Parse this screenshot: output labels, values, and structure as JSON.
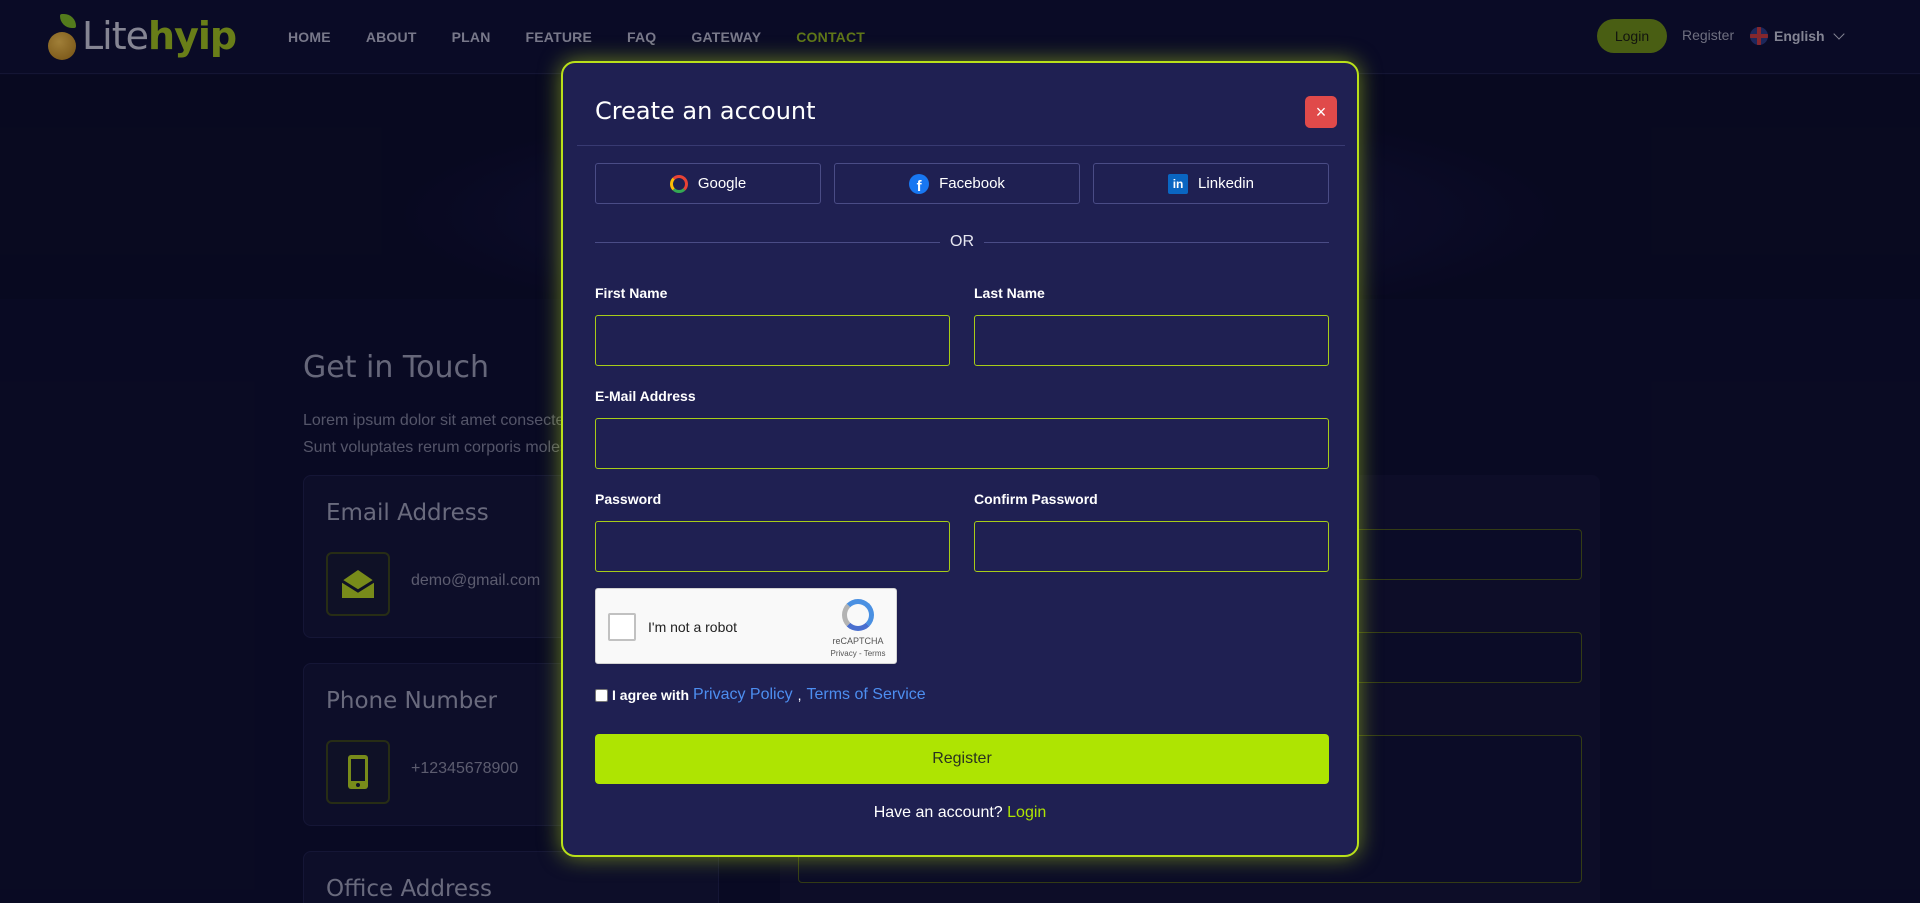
{
  "brand": {
    "lite": "Lite",
    "hyip": "hyip"
  },
  "nav": {
    "items": [
      {
        "label": "HOME"
      },
      {
        "label": "ABOUT"
      },
      {
        "label": "PLAN"
      },
      {
        "label": "FEATURE"
      },
      {
        "label": "FAQ"
      },
      {
        "label": "GATEWAY"
      },
      {
        "label": "CONTACT",
        "active": true
      }
    ],
    "login_label": "Login",
    "register_label": "Register",
    "language": "English"
  },
  "page": {
    "title": "Get in Touch",
    "intro_line1": "Lorem ipsum dolor sit amet consectetur",
    "intro_line2": "Sunt voluptates rerum corporis molestias",
    "cards": [
      {
        "title": "Email Address",
        "value": "demo@gmail.com",
        "icon": "envelope-icon"
      },
      {
        "title": "Phone Number",
        "value": "+12345678900",
        "icon": "phone-icon"
      },
      {
        "title": "Office Address",
        "value": "",
        "icon": "location-icon"
      }
    ]
  },
  "modal": {
    "title": "Create an account",
    "close_icon": "×",
    "social": [
      {
        "label": "Google",
        "icon": "google-icon"
      },
      {
        "label": "Facebook",
        "icon": "facebook-icon"
      },
      {
        "label": "Linkedin",
        "icon": "linkedin-icon"
      }
    ],
    "or_text": "OR",
    "fields": {
      "first_name": {
        "label": "First Name",
        "value": ""
      },
      "last_name": {
        "label": "Last Name",
        "value": ""
      },
      "email": {
        "label": "E-Mail Address",
        "value": ""
      },
      "password": {
        "label": "Password",
        "value": ""
      },
      "confirm_password": {
        "label": "Confirm Password",
        "value": ""
      }
    },
    "captcha": {
      "label": "I'm not a robot",
      "brand": "reCAPTCHA",
      "terms": "Privacy - Terms"
    },
    "agree": {
      "text": "I agree with",
      "privacy": "Privacy Policy",
      "separator": ",",
      "terms": "Terms of Service"
    },
    "submit_label": "Register",
    "footer": {
      "text": "Have an account?",
      "link": "Login"
    }
  },
  "colors": {
    "accent": "#aee402",
    "modal_bg": "#1f2052",
    "page_bg": "#0c0d2a",
    "close": "#e04a4a",
    "link": "#4d8ef0"
  }
}
